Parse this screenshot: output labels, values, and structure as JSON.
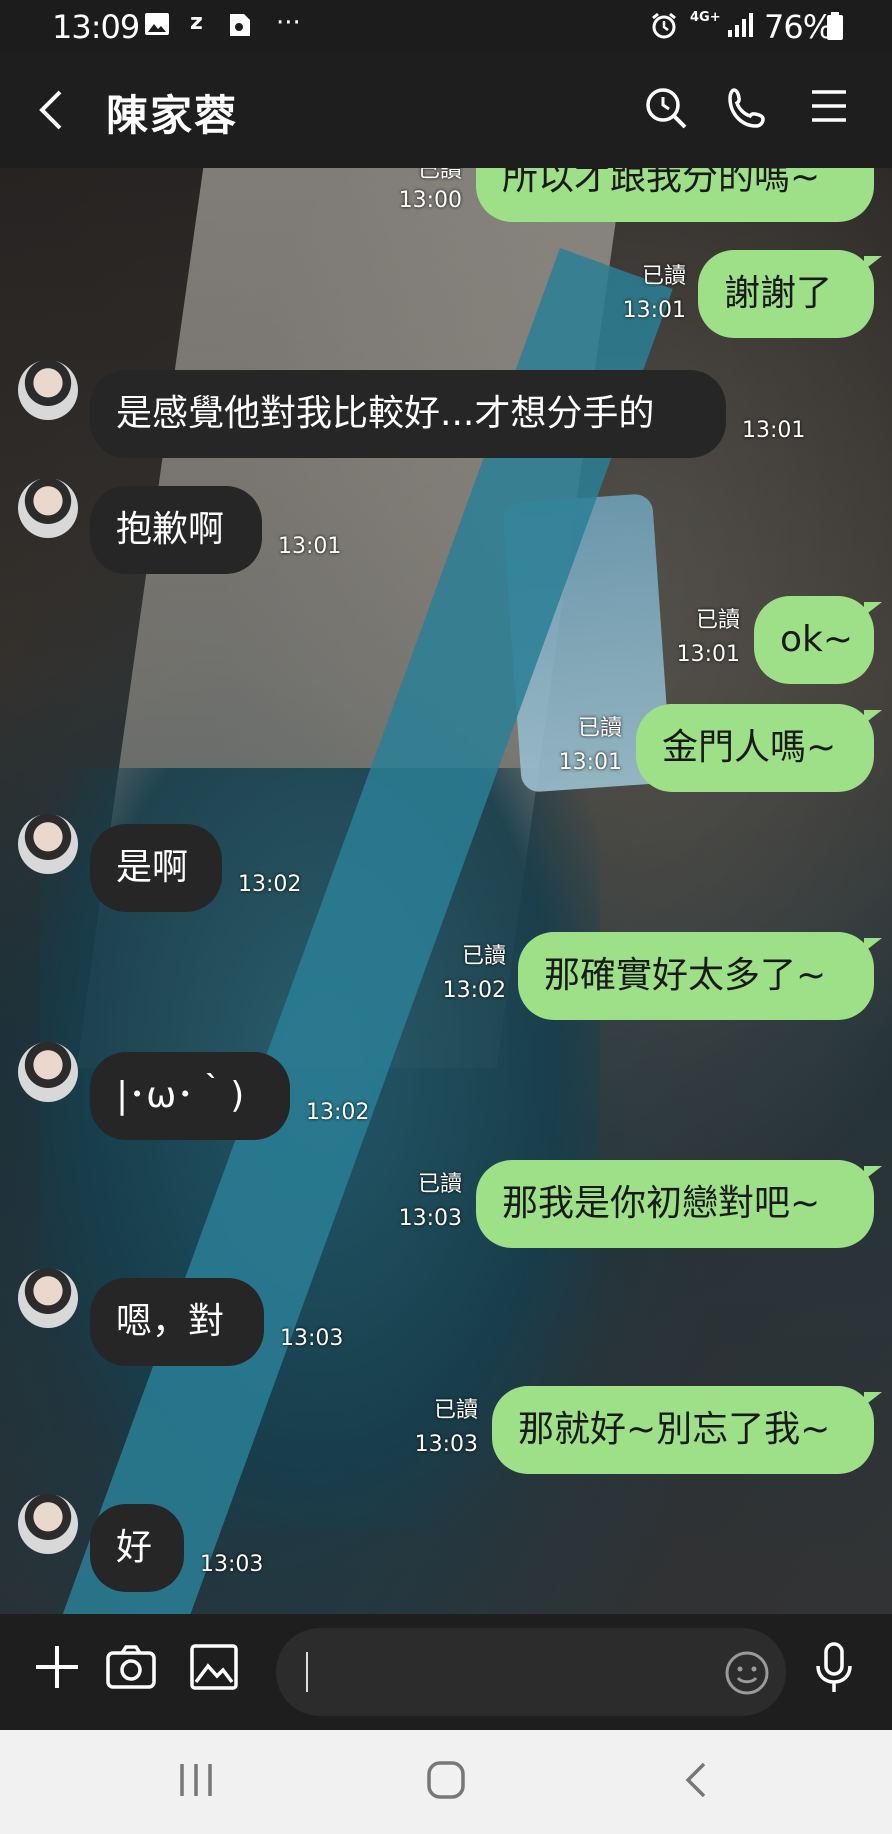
{
  "status_bar": {
    "time": "13:09",
    "network": "4G+",
    "battery": "76%"
  },
  "header": {
    "title": "陳家蓉"
  },
  "messages": [
    {
      "dir": "out",
      "text": "所以才跟我分的嗎~",
      "read": "已讀",
      "time": "13:00"
    },
    {
      "dir": "out",
      "text": "謝謝了",
      "read": "已讀",
      "time": "13:01"
    },
    {
      "dir": "in",
      "text": "是感覺他對我比較好...才想分手的",
      "time": "13:01"
    },
    {
      "dir": "in",
      "text": "抱歉啊",
      "time": "13:01"
    },
    {
      "dir": "out",
      "text": "ok~",
      "read": "已讀",
      "time": "13:01"
    },
    {
      "dir": "out",
      "text": "金門人嗎~",
      "read": "已讀",
      "time": "13:01"
    },
    {
      "dir": "in",
      "text": "是啊",
      "time": "13:02"
    },
    {
      "dir": "out",
      "text": "那確實好太多了~",
      "read": "已讀",
      "time": "13:02"
    },
    {
      "dir": "in",
      "text": "|･ω･｀)",
      "time": "13:02"
    },
    {
      "dir": "out",
      "text": "那我是你初戀對吧~",
      "read": "已讀",
      "time": "13:03"
    },
    {
      "dir": "in",
      "text": "嗯，對",
      "time": "13:03"
    },
    {
      "dir": "out",
      "text": "那就好~別忘了我~",
      "read": "已讀",
      "time": "13:03"
    },
    {
      "dir": "in",
      "text": "好",
      "time": "13:03"
    }
  ],
  "input": {
    "value": ""
  },
  "colors": {
    "bubble_out": "#9ee087",
    "bubble_in": "#262626",
    "bar": "#1e1e1e"
  }
}
